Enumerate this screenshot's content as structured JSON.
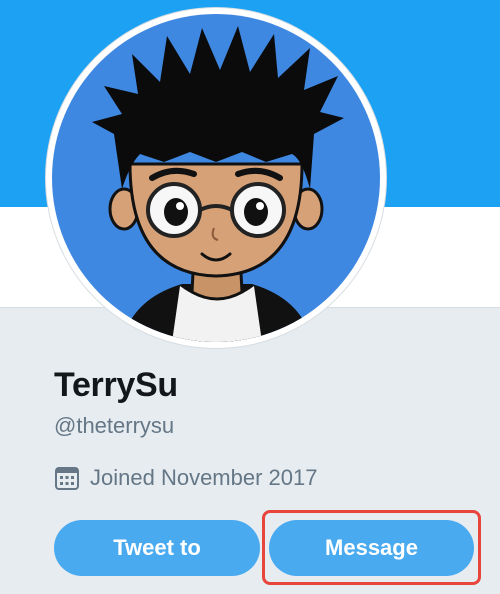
{
  "profile": {
    "name": "TerrySu",
    "handle": "@theterrysu",
    "joined": "Joined November 2017",
    "avatar_icon": "cartoon-avatar",
    "calendar_icon": "calendar-icon"
  },
  "actions": {
    "tweet_to_label": "Tweet to",
    "message_label": "Message"
  },
  "colors": {
    "banner": "#1da1f2",
    "button": "#4aaaf0",
    "highlight": "#e8453c",
    "background": "#e6ecf0"
  }
}
